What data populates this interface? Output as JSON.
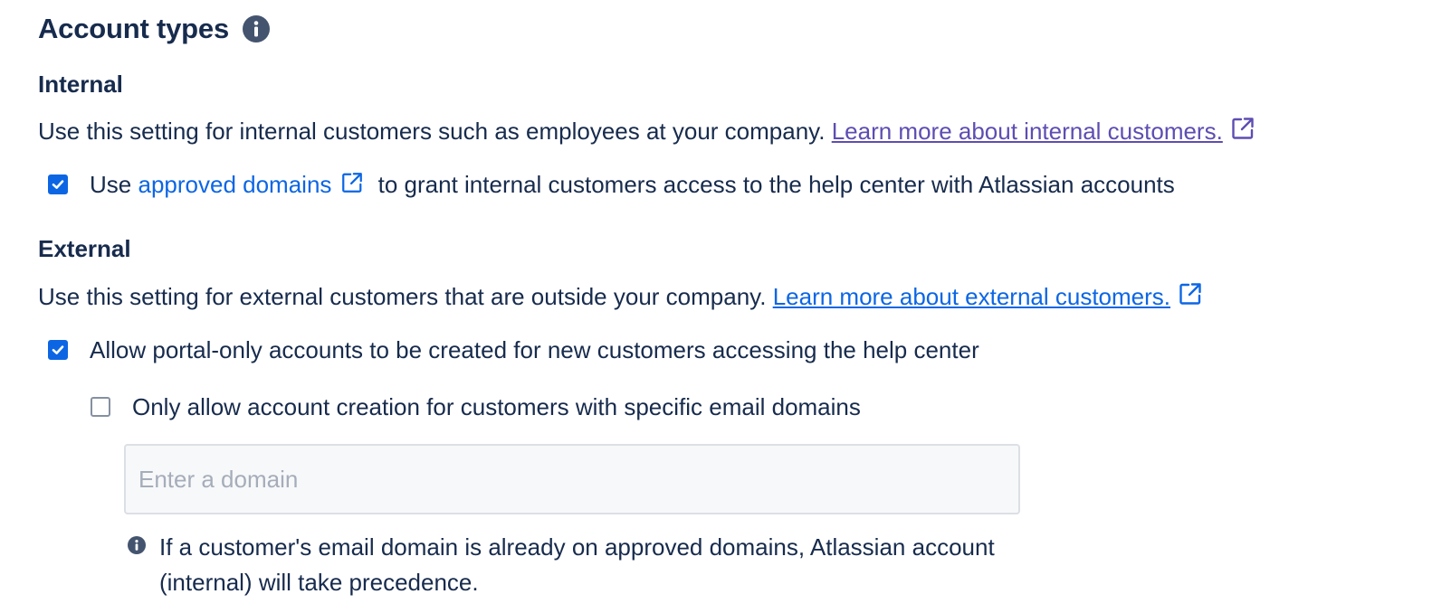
{
  "section": {
    "title": "Account types",
    "title_icon": "info-icon"
  },
  "internal": {
    "heading": "Internal",
    "description": "Use this setting for internal customers such as employees at your company.",
    "learn_more_link": "Learn more about internal customers.",
    "checkbox": {
      "checked": true,
      "prefix": "Use",
      "link": "approved domains",
      "suffix": "to grant internal customers access to the help center with Atlassian accounts"
    }
  },
  "external": {
    "heading": "External",
    "description": "Use this setting for external customers that are outside your company.",
    "learn_more_link": "Learn more about external customers.",
    "portal_checkbox": {
      "checked": true,
      "label": "Allow portal-only accounts to be created for new customers accessing the help center"
    },
    "domain_checkbox": {
      "checked": false,
      "label": "Only allow account creation for customers with specific email domains"
    },
    "domain_input": {
      "value": "",
      "placeholder": "Enter a domain"
    },
    "note": "If a customer's email domain is already on approved domains, Atlassian account (internal) will take precedence."
  },
  "colors": {
    "text": "#172b4d",
    "link_visited": "#5e4db2",
    "link": "#0c66e4",
    "checkbox_checked": "#0c66e4",
    "icon": "#44546f"
  }
}
